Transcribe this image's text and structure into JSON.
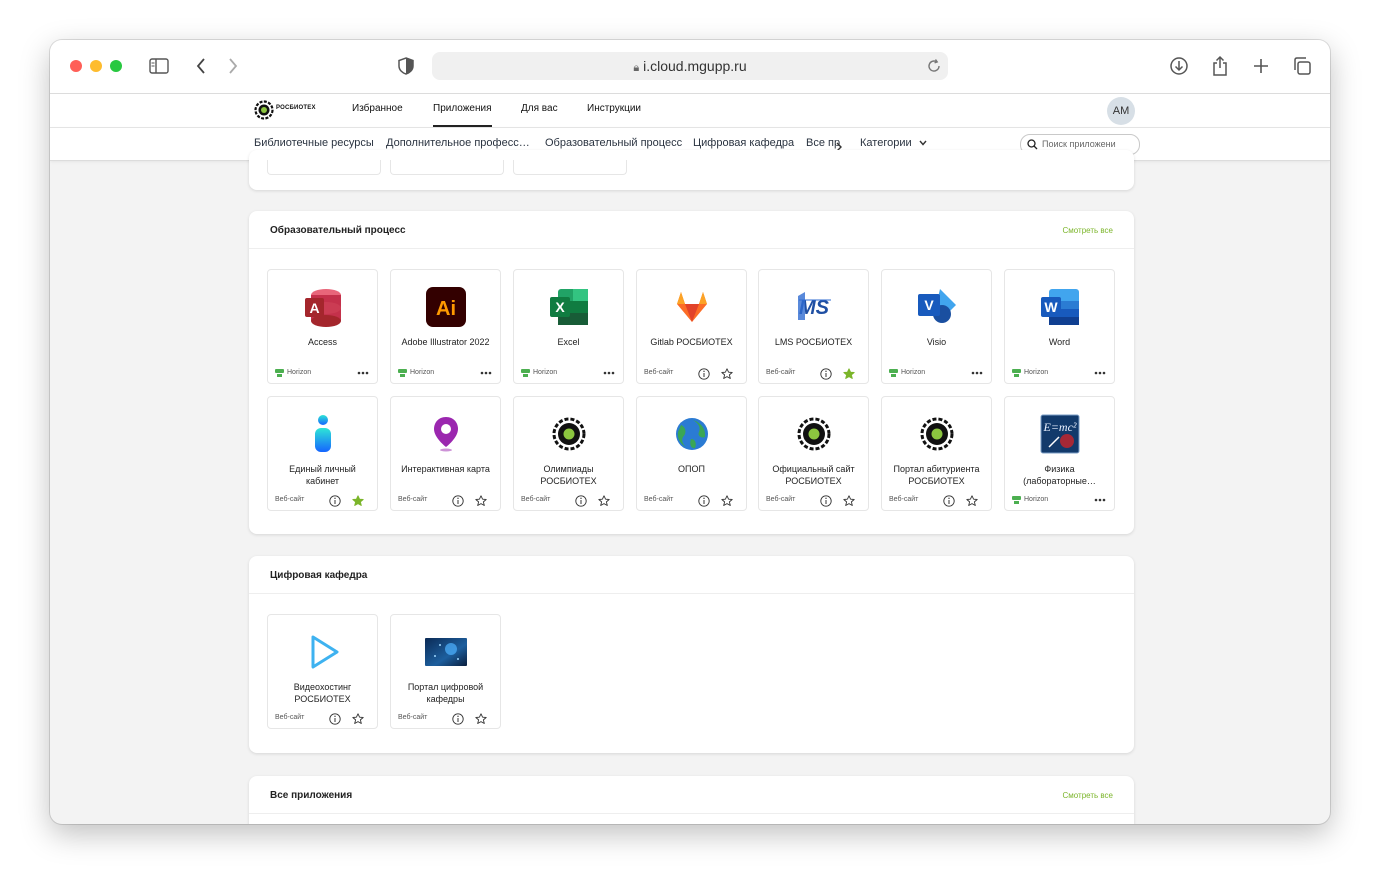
{
  "browser": {
    "url": "i.cloud.mgupp.ru"
  },
  "header": {
    "logo_text": "РОСБИОТЕХ",
    "nav": [
      {
        "label": "Избранное"
      },
      {
        "label": "Приложения"
      },
      {
        "label": "Для вас"
      },
      {
        "label": "Инструкции"
      }
    ],
    "active_nav": "Приложения",
    "avatar": "АМ"
  },
  "category_bar": {
    "items": [
      {
        "label": "Библиотечные ресурсы"
      },
      {
        "label": "Дополнительное професс…"
      },
      {
        "label": "Образовательный процесс"
      },
      {
        "label": "Цифровая кафедра"
      },
      {
        "label": "Все пр"
      }
    ],
    "categories_label": "Категории",
    "search_placeholder": "Поиск приложени"
  },
  "sections": [
    {
      "title": "Образовательный процесс",
      "see_all": "Смотреть все",
      "apps": [
        {
          "name": "Access",
          "type": "Horizon",
          "icon": "access-icon",
          "menu": true
        },
        {
          "name": "Adobe Illustrator 2022",
          "type": "Horizon",
          "icon": "illustrator-icon",
          "menu": true
        },
        {
          "name": "Excel",
          "type": "Horizon",
          "icon": "excel-icon",
          "menu": true
        },
        {
          "name": "Gitlab РОСБИОТЕХ",
          "type": "Веб-сайт",
          "icon": "gitlab-icon",
          "favorite": false
        },
        {
          "name": "LMS РОСБИОТЕХ",
          "type": "Веб-сайт",
          "icon": "lms-icon",
          "favorite": true
        },
        {
          "name": "Visio",
          "type": "Horizon",
          "icon": "visio-icon",
          "menu": true
        },
        {
          "name": "Word",
          "type": "Horizon",
          "icon": "word-icon",
          "menu": true
        },
        {
          "name": "Единый личный кабинет",
          "type": "Веб-сайт",
          "icon": "cabinet-icon",
          "favorite": true
        },
        {
          "name": "Интерактивная карта",
          "type": "Веб-сайт",
          "icon": "map-pin-icon",
          "favorite": false
        },
        {
          "name": "Олимпиады РОСБИОТЕХ",
          "type": "Веб-сайт",
          "icon": "rosbiotech-icon",
          "favorite": false
        },
        {
          "name": "ОПОП",
          "type": "Веб-сайт",
          "icon": "globe-icon",
          "favorite": false
        },
        {
          "name": "Официальный сайт РОСБИОТЕХ",
          "type": "Веб-сайт",
          "icon": "rosbiotech-icon",
          "favorite": false
        },
        {
          "name": "Портал абитуриента РОСБИОТЕХ",
          "type": "Веб-сайт",
          "icon": "rosbiotech-icon",
          "favorite": false
        },
        {
          "name": "Физика (лабораторные…",
          "type": "Horizon",
          "icon": "physics-icon",
          "menu": true
        }
      ]
    },
    {
      "title": "Цифровая кафедра",
      "apps": [
        {
          "name": "Видеохостинг РОСБИОТЕХ",
          "type": "Веб-сайт",
          "icon": "play-icon",
          "favorite": false
        },
        {
          "name": "Портал цифровой кафедры",
          "type": "Веб-сайт",
          "icon": "digital-portal-icon",
          "favorite": false
        }
      ]
    },
    {
      "title": "Все приложения",
      "see_all": "Смотреть все"
    }
  ],
  "colors": {
    "accent": "#7bb52a",
    "horizon": "#4caf50",
    "star_filled": "#7bb52a"
  }
}
